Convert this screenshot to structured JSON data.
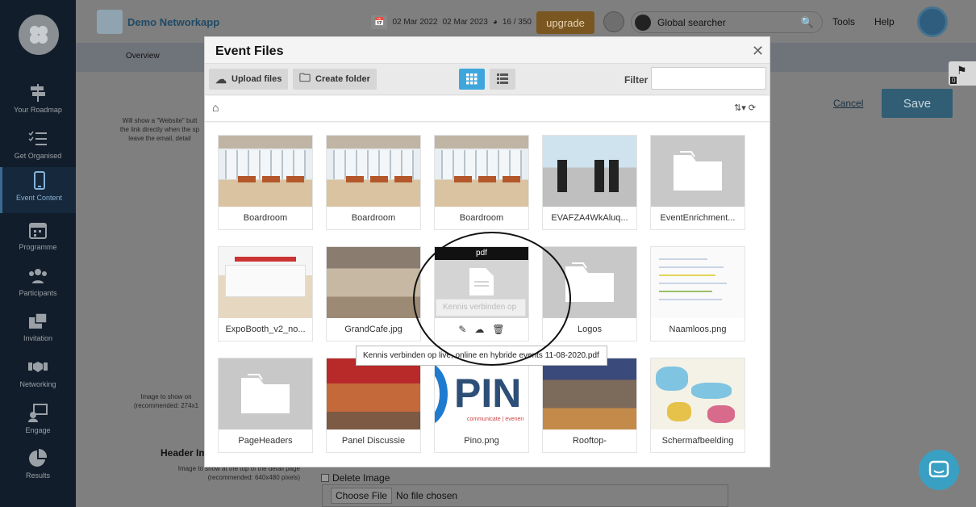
{
  "app": {
    "name": "Demo Networkapp"
  },
  "sidebar": {
    "items": [
      {
        "label": "Your Roadmap",
        "icon": "signpost-icon"
      },
      {
        "label": "Get Organised",
        "icon": "checklist-icon"
      },
      {
        "label": "Event Content",
        "icon": "mobile-icon",
        "active": true
      },
      {
        "label": "Programme",
        "icon": "calendar-icon"
      },
      {
        "label": "Participants",
        "icon": "people-icon"
      },
      {
        "label": "Invitation",
        "icon": "invitation-icon"
      },
      {
        "label": "Networking",
        "icon": "handshake-icon"
      },
      {
        "label": "Engage",
        "icon": "engage-icon"
      },
      {
        "label": "Results",
        "icon": "pie-chart-icon"
      }
    ]
  },
  "topbar": {
    "date_start": "02 Mar 2022",
    "date_end": "02 Mar 2023",
    "usage": "16 / 350",
    "upgrade": "upgrade",
    "search_placeholder": "Global searcher",
    "tools": "Tools",
    "help": "Help"
  },
  "subbar": {
    "overview": "Overview"
  },
  "background": {
    "website_hint_1": "Will show a \"Website\" butt",
    "website_hint_2": "the link directly when the sp",
    "website_hint_3": "leave the email, detail",
    "image_hint_1": "Image to show on",
    "image_hint_2": "(recommended: 274x1",
    "header_image_label": "Header Im",
    "header_image_hint_1": "Image to show at the top of the detail page",
    "header_image_hint_2": "(recommended: 640x480 pixels)",
    "delete_image": "Delete Image",
    "choose_file": "Choose File",
    "no_file": "No file chosen",
    "cancel": "Cancel",
    "save": "Save",
    "tag_count": "0"
  },
  "modal": {
    "title": "Event Files",
    "upload": "Upload files",
    "create_folder": "Create folder",
    "filter_label": "Filter",
    "filter_value": "",
    "files": [
      {
        "name": "Boardroom",
        "kind": "room"
      },
      {
        "name": "Boardroom",
        "kind": "room"
      },
      {
        "name": "Boardroom",
        "kind": "room"
      },
      {
        "name": "EVAFZA4WkAluq...",
        "kind": "expo"
      },
      {
        "name": "EventEnrichment...",
        "kind": "folder"
      },
      {
        "name": "ExpoBooth_v2_no...",
        "kind": "booth"
      },
      {
        "name": "GrandCafe.jpg",
        "kind": "cafe"
      },
      {
        "name": "Kennis verbinden op",
        "kind": "pdf",
        "badge": "pdf"
      },
      {
        "name": "Logos",
        "kind": "folder"
      },
      {
        "name": "Naamloos.png",
        "kind": "screen"
      },
      {
        "name": "PageHeaders",
        "kind": "folder"
      },
      {
        "name": "Panel Discussie",
        "kind": "panel"
      },
      {
        "name": "Pino.png",
        "kind": "pino"
      },
      {
        "name": "Rooftop-",
        "kind": "roof"
      },
      {
        "name": "Schermafbeelding",
        "kind": "map"
      }
    ],
    "pino_text": "PIN",
    "pino_sub": "communicate | evenen",
    "tooltip": "Kennis verbinden op live, online en hybride events 11-08-2020.pdf"
  }
}
